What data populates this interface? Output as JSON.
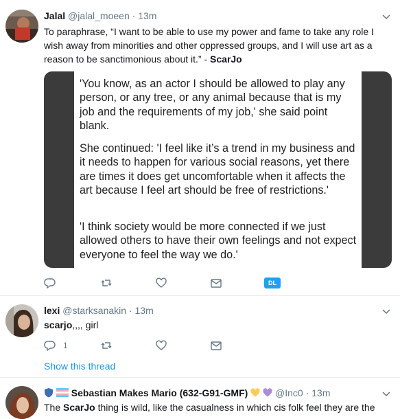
{
  "tweets": [
    {
      "name": "Jalal",
      "handle": "@jalal_moeen",
      "dot": "·",
      "time": "13m",
      "text_before": "To paraphrase, “I want to be able to use my power and fame to take any role I wish away from minorities and other oppressed groups, and I will use art as a reason to be sanctimonious about it.” - ",
      "text_bold": "ScarJo",
      "quote": [
        "'You know, as an actor I should be allowed to play any person, or any tree, or any animal because that is my job and the requirements of my job,' she said point blank.",
        "She continued: 'I feel like it’s a trend in my business and it needs to happen for various social reasons, yet there are times it does get uncomfortable when it affects the art because I feel art should be free of restrictions.'",
        "'I think society would be more connected if we just allowed others to have their own feelings and not expect everyone to feel the way we do.'"
      ],
      "badge": "DL"
    },
    {
      "name": "lexi",
      "handle": "@starksanakin",
      "dot": "·",
      "time": "13m",
      "text_bold": "scarjo",
      "text_after": ",,,, girl",
      "reply_count": "1",
      "show_thread": "Show this thread"
    },
    {
      "name": "Sebastian Makes Mario (632-G91-GMF)",
      "handle": "@Inc0",
      "dot": "·",
      "time": "13m",
      "text_before": "The ",
      "text_bold": "ScarJo",
      "text_after": " thing is wild, like the casualness in which cis folk feel they are the"
    }
  ],
  "colors": {
    "accent": "#1da1f2",
    "link": "#1b95e0",
    "muted": "#657786",
    "heart_yellow": "#fdcb58",
    "heart_purple": "#aa8ed6"
  },
  "icons": [
    "reply-icon",
    "retweet-icon",
    "like-icon",
    "dm-icon",
    "chevron-down-icon"
  ]
}
